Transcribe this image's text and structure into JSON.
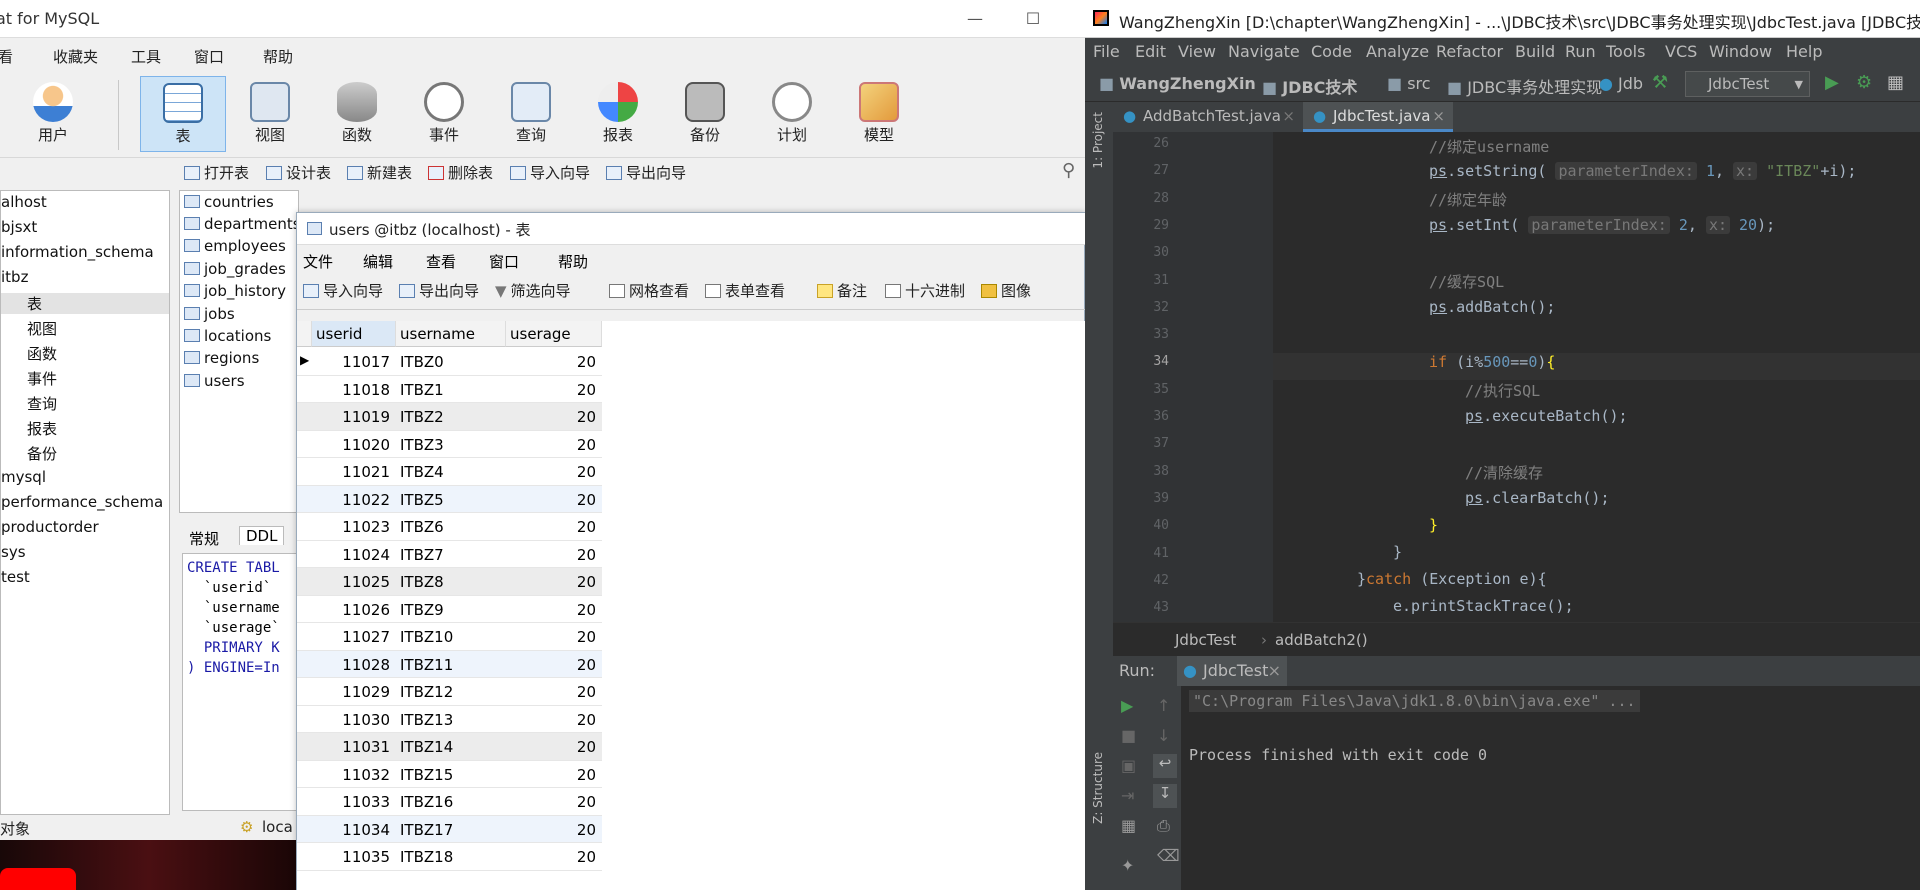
{
  "navicat": {
    "title": "at for MySQL",
    "menu": [
      "看",
      "收藏夹",
      "工具",
      "窗口",
      "帮助"
    ],
    "toolbar": [
      "用户",
      "表",
      "视图",
      "函数",
      "事件",
      "查询",
      "报表",
      "备份",
      "计划",
      "模型"
    ],
    "sub_toolbar": [
      "打开表",
      "设计表",
      "新建表",
      "删除表",
      "导入向导",
      "导出向导"
    ],
    "tree": [
      "alhost",
      "bjsxt",
      "information_schema",
      "itbz",
      "表",
      "视图",
      "函数",
      "事件",
      "查询",
      "报表",
      "备份",
      "mysql",
      "performance_schema",
      "productorder",
      "sys",
      "test"
    ],
    "tables": [
      "countries",
      "departments",
      "employees",
      "job_grades",
      "job_history",
      "jobs",
      "locations",
      "regions",
      "users"
    ],
    "info_tabs": [
      "常规",
      "DDL"
    ],
    "ddl": [
      "CREATE TABL",
      "  `userid`",
      "  `username",
      "  `userage`",
      "  PRIMARY K",
      ") ENGINE=In"
    ],
    "status": "对象",
    "status2": "loca"
  },
  "users_window": {
    "title": "users @itbz (localhost) - 表",
    "menu": [
      "文件",
      "编辑",
      "查看",
      "窗口",
      "帮助"
    ],
    "toolbar": [
      "导入向导",
      "导出向导",
      "筛选向导",
      "网格查看",
      "表单查看",
      "备注",
      "十六进制",
      "图像"
    ],
    "columns": [
      "userid",
      "username",
      "userage"
    ],
    "rows": [
      [
        "11017",
        "ITBZ0",
        "20"
      ],
      [
        "11018",
        "ITBZ1",
        "20"
      ],
      [
        "11019",
        "ITBZ2",
        "20"
      ],
      [
        "11020",
        "ITBZ3",
        "20"
      ],
      [
        "11021",
        "ITBZ4",
        "20"
      ],
      [
        "11022",
        "ITBZ5",
        "20"
      ],
      [
        "11023",
        "ITBZ6",
        "20"
      ],
      [
        "11024",
        "ITBZ7",
        "20"
      ],
      [
        "11025",
        "ITBZ8",
        "20"
      ],
      [
        "11026",
        "ITBZ9",
        "20"
      ],
      [
        "11027",
        "ITBZ10",
        "20"
      ],
      [
        "11028",
        "ITBZ11",
        "20"
      ],
      [
        "11029",
        "ITBZ12",
        "20"
      ],
      [
        "11030",
        "ITBZ13",
        "20"
      ],
      [
        "11031",
        "ITBZ14",
        "20"
      ],
      [
        "11032",
        "ITBZ15",
        "20"
      ],
      [
        "11033",
        "ITBZ16",
        "20"
      ],
      [
        "11034",
        "ITBZ17",
        "20"
      ],
      [
        "11035",
        "ITBZ18",
        "20"
      ]
    ]
  },
  "ide": {
    "title": "WangZhengXin [D:\\chapter\\WangZhengXin] - ...\\JDBC技术\\src\\JDBC事务处理实现\\JdbcTest.java [JDBC技术] - I...",
    "menu": [
      "File",
      "Edit",
      "View",
      "Navigate",
      "Code",
      "Analyze",
      "Refactor",
      "Build",
      "Run",
      "Tools",
      "VCS",
      "Window",
      "Help"
    ],
    "breadcrumb": [
      "WangZhengXin",
      "JDBC技术",
      "src",
      "JDBC事务处理实现",
      "Jdb"
    ],
    "run_config": "JdbcTest",
    "tabs": [
      "AddBatchTest.java",
      "JdbcTest.java"
    ],
    "side_tabs": [
      "1: Project",
      "Z: Structure"
    ],
    "line_numbers": [
      "26",
      "27",
      "28",
      "29",
      "30",
      "31",
      "32",
      "33",
      "34",
      "35",
      "36",
      "37",
      "38",
      "39",
      "40",
      "41",
      "42",
      "43"
    ],
    "crumb": [
      "JdbcTest",
      "addBatch2()"
    ],
    "run_label": "Run:",
    "run_tab": "JdbcTest",
    "output": [
      "\"C:\\Program Files\\Java\\jdk1.8.0\\bin\\java.exe\" ...",
      "Process finished with exit code 0"
    ]
  }
}
